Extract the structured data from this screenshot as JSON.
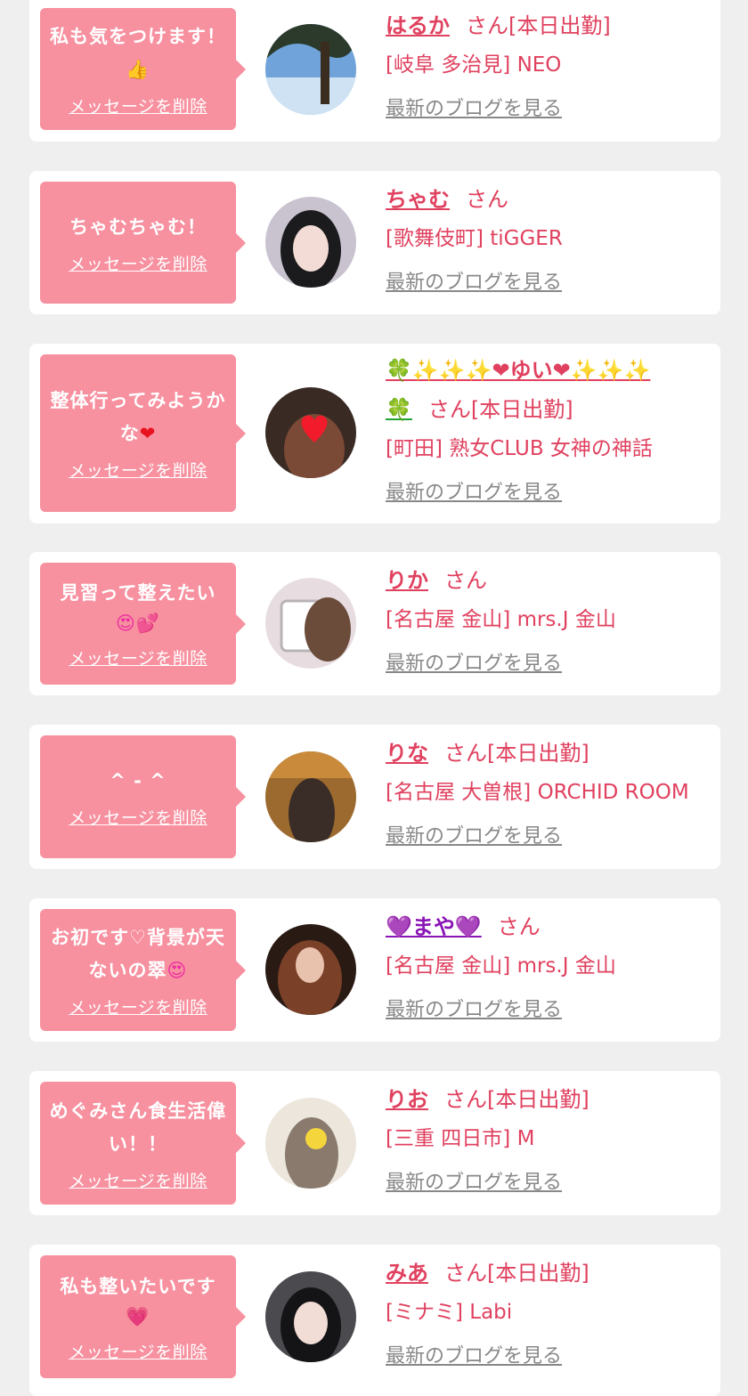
{
  "delete_label": "メッセージを削除",
  "blog_label": "最新のブログを見る",
  "cards": [
    {
      "message": "私も気をつけます！",
      "message_icon": "👍",
      "name": "はるか",
      "suffix": "さん[本日出勤]",
      "shop": "[岐阜 多治見] NEO"
    },
    {
      "message": "ちゃむちゃむ！",
      "name": "ちゃむ",
      "suffix": "さん",
      "shop": "[歌舞伎町] tiGGER"
    },
    {
      "message": "整体行ってみようかな",
      "message_icon": "❤",
      "name_line1": "🍀✨✨✨❤ゆい❤✨✨✨",
      "name_line2": "🍀",
      "suffix": "さん[本日出勤]",
      "shop": "[町田] 熟女CLUB 女神の神話"
    },
    {
      "message": "見習って整えたい",
      "message_icon": "😍💕",
      "name": "りか",
      "suffix": "さん",
      "shop": "[名古屋 金山] mrs.J 金山"
    },
    {
      "message": "^ - ^",
      "name": "りな",
      "suffix": "さん[本日出勤]",
      "shop": "[名古屋 大曽根] ORCHID ROOM"
    },
    {
      "message": "お初です♡背景が天ないの翠",
      "message_icon": "😍",
      "name": "💜まや💜",
      "suffix": "さん",
      "shop": "[名古屋 金山] mrs.J 金山"
    },
    {
      "message": "めぐみさん食生活偉い！！",
      "name": "りお",
      "suffix": "さん[本日出勤]",
      "shop": "[三重 四日市] M"
    },
    {
      "message": "私も整いたいです",
      "message_icon": "💗",
      "name": "みあ",
      "suffix": "さん[本日出勤]",
      "shop": "[ミナミ] Labi"
    }
  ]
}
